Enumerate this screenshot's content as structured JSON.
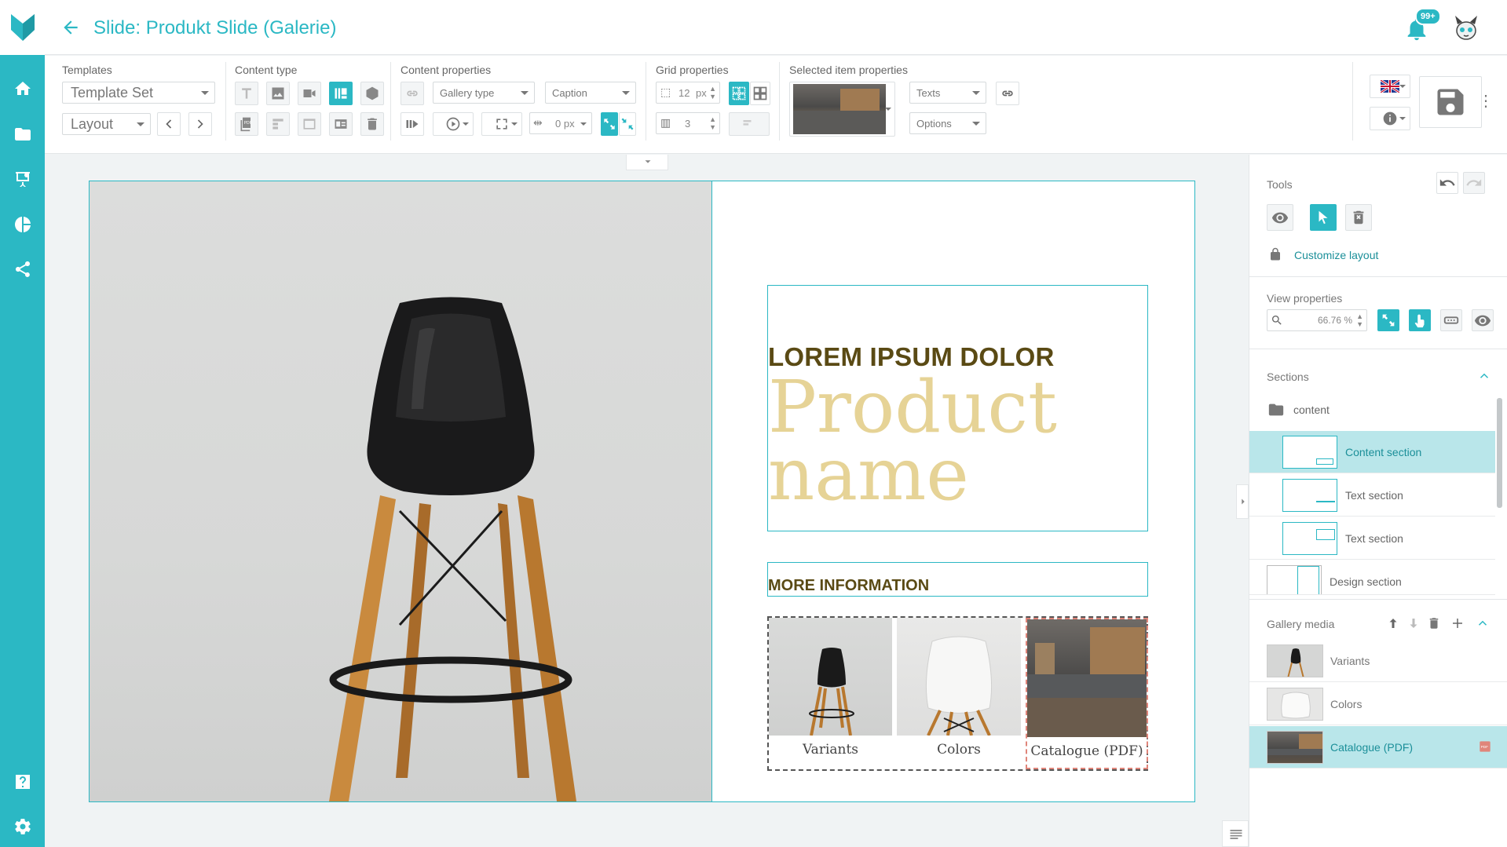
{
  "header": {
    "title": "Slide: Produkt Slide (Galerie)",
    "notification_count": "99+"
  },
  "toolbar": {
    "templates": {
      "label": "Templates",
      "template_set": "Template Set",
      "layout": "Layout"
    },
    "content_type": {
      "label": "Content type"
    },
    "content_properties": {
      "label": "Content properties",
      "gallery_type": "Gallery type",
      "caption": "Caption",
      "spacing": "0 px"
    },
    "grid_properties": {
      "label": "Grid properties",
      "gap_value": "12",
      "gap_unit": "px",
      "columns": "3"
    },
    "selected_item_properties": {
      "label": "Selected item properties",
      "texts": "Texts",
      "options": "Options"
    }
  },
  "slide": {
    "kicker": "LOREM IPSUM DOLOR",
    "product_name": "Product name",
    "more_info": "MORE INFORMATION",
    "gallery": [
      {
        "label": "Variants"
      },
      {
        "label": "Colors"
      },
      {
        "label": "Catalogue (PDF)"
      }
    ]
  },
  "panel": {
    "tools_label": "Tools",
    "customize_layout": "Customize layout",
    "view_properties_label": "View properties",
    "zoom": "66.76 %",
    "sections_label": "Sections",
    "folder": "content",
    "sections": [
      {
        "label": "Content section"
      },
      {
        "label": "Text section"
      },
      {
        "label": "Text section"
      },
      {
        "label": "Design section"
      }
    ],
    "gallery_media_label": "Gallery media",
    "media": [
      {
        "label": "Variants"
      },
      {
        "label": "Colors"
      },
      {
        "label": "Catalogue (PDF)"
      }
    ]
  },
  "colors": {
    "accent": "#2bb8c4",
    "kicker": "#5a4a14",
    "product_name": "#e6d396",
    "selected_row": "#b9e6ea"
  },
  "icons": [
    "logo-icon",
    "home-icon",
    "folder-icon",
    "presentation-icon",
    "chart-pie-icon",
    "share-icon",
    "help-icon",
    "settings-icon",
    "back-arrow-icon",
    "bell-icon",
    "avatar-icon",
    "save-icon",
    "undo-icon",
    "redo-icon",
    "eye-icon",
    "cursor-icon",
    "delete-icon",
    "lock-icon",
    "zoom-icon",
    "pdf-icon"
  ]
}
